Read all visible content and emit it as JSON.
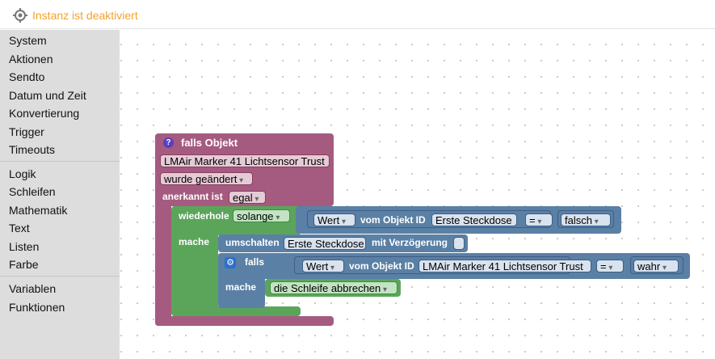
{
  "header": {
    "status_text": "Instanz ist deaktiviert",
    "status_icon": "crosshair-icon",
    "status_color": "#f3a22b"
  },
  "sidebar": {
    "groups": [
      [
        "System",
        "Aktionen",
        "Sendto",
        "Datum und Zeit",
        "Konvertierung",
        "Trigger",
        "Timeouts"
      ],
      [
        "Logik",
        "Schleifen",
        "Mathematik",
        "Text",
        "Listen",
        "Farbe"
      ],
      [
        "Variablen",
        "Funktionen"
      ]
    ]
  },
  "colors": {
    "trigger_block": "#a55b80",
    "loop_block": "#5ba55b",
    "logic_block": "#5b80a5",
    "sidebar_bg": "#dddddd"
  },
  "blocks": {
    "trigger": {
      "title": "falls Objekt",
      "object_name": "LMAir Marker 41 Lichtsensor Trust",
      "change_mode": "wurde geändert",
      "ack_label": "anerkannt ist",
      "ack_value": "egal",
      "help_icon": "question-icon"
    },
    "loop": {
      "label": "wiederhole",
      "mode": "solange",
      "do_label": "mache",
      "condition": {
        "prop": "Wert",
        "of_label": "vom Objekt ID",
        "object_id": "Erste Steckdose",
        "operator": "=",
        "value": "falsch"
      }
    },
    "toggle": {
      "label": "umschalten",
      "object_id": "Erste Steckdose",
      "delay_label": "mit Verzögerung"
    },
    "if_block": {
      "label": "falls",
      "gear_icon": "gear-icon",
      "do_label": "mache",
      "condition": {
        "prop": "Wert",
        "of_label": "vom Objekt ID",
        "object_id": "LMAir Marker 41 Lichtsensor Trust",
        "operator": "=",
        "value": "wahr"
      }
    },
    "break": {
      "label": "die Schleife abbrechen"
    }
  }
}
